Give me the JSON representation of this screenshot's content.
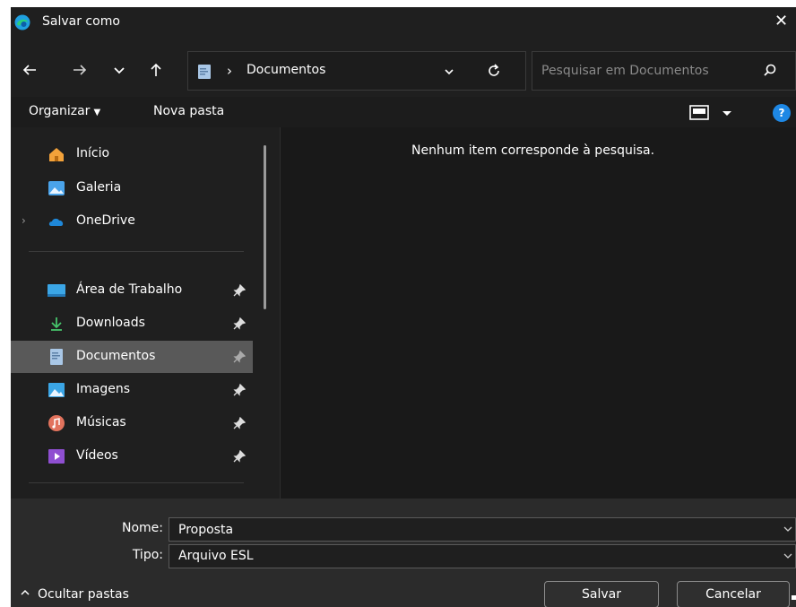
{
  "window": {
    "title": "Salvar como",
    "close_glyph": "✕"
  },
  "nav": {
    "back_icon": "arrow-left-icon",
    "forward_icon": "arrow-right-icon",
    "recent_icon": "chevron-down-icon",
    "up_icon": "arrow-up-icon",
    "breadcrumb_separator": "›",
    "breadcrumb": "Documentos",
    "search_placeholder": "Pesquisar em Documentos"
  },
  "toolbar": {
    "organize_label": "Organizar",
    "new_folder_label": "Nova pasta",
    "help_glyph": "?"
  },
  "sidebar": {
    "items": [
      {
        "label": "Início",
        "icon": "home-icon"
      },
      {
        "label": "Galeria",
        "icon": "gallery-icon"
      },
      {
        "label": "OneDrive",
        "icon": "cloud-icon",
        "expander": "›"
      },
      {
        "label": "Área de Trabalho",
        "icon": "desktop-icon",
        "pinned": true
      },
      {
        "label": "Downloads",
        "icon": "download-icon",
        "pinned": true
      },
      {
        "label": "Documentos",
        "icon": "documents-icon",
        "pinned": true,
        "selected": true
      },
      {
        "label": "Imagens",
        "icon": "pictures-icon",
        "pinned": true
      },
      {
        "label": "Músicas",
        "icon": "music-icon",
        "pinned": true
      },
      {
        "label": "Vídeos",
        "icon": "videos-icon",
        "pinned": true
      }
    ]
  },
  "content": {
    "empty_message": "Nenhum item corresponde à pesquisa."
  },
  "form": {
    "name_label": "Nome:",
    "name_value": "Proposta",
    "type_label": "Tipo:",
    "type_value": "Arquivo ESL"
  },
  "footer": {
    "hide_folders_label": "Ocultar pastas",
    "save_label": "Salvar",
    "cancel_label": "Cancelar"
  },
  "colors": {
    "background": "#1f1f1f",
    "selected": "#595959",
    "accent": "#1e88e5"
  }
}
